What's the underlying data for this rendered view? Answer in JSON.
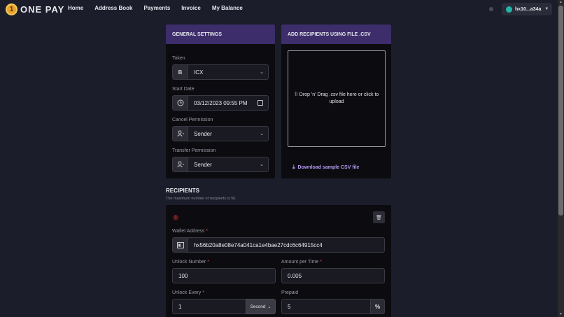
{
  "header": {
    "logo_letter": "1",
    "logo_text": "ONE PAY",
    "nav": [
      "Home",
      "Address Book",
      "Payments",
      "Invoice",
      "My Balance"
    ],
    "wallet": "hx10...a34a"
  },
  "general_settings": {
    "title": "GENERAL SETTINGS",
    "token_label": "Token",
    "token_icon": "B",
    "token_value": "ICX",
    "start_date_label": "Start Date",
    "start_date_value": "03/12/2023 09:55 PM",
    "cancel_label": "Cancel Permission",
    "cancel_value": "Sender",
    "transfer_label": "Transfer Permission",
    "transfer_value": "Sender"
  },
  "csv": {
    "title": "ADD RECIPIENTS USING FILE .CSV",
    "drop_text": "Drop 'n' Drag .csv file here or click to upload",
    "download_label": "Download sample CSV file"
  },
  "recipients": {
    "title": "RECIPIENTS",
    "subtitle": "The maximum number of recipients is 50.",
    "index": "1",
    "wallet_label": "Wallet Address",
    "wallet_value": "hx56b20a8e08e74a041ca1e4bae27cdc6c64915cc4",
    "unlock_number_label": "Unlock Number",
    "unlock_number_value": "100",
    "amount_label": "Amount per Time",
    "amount_value": "0.005",
    "unlock_every_label": "Unlock Every",
    "unlock_every_value": "1",
    "unlock_unit": "Second",
    "prepaid_label": "Prepaid",
    "prepaid_value": "5",
    "prepaid_suffix": "%",
    "required_mark": "*"
  }
}
